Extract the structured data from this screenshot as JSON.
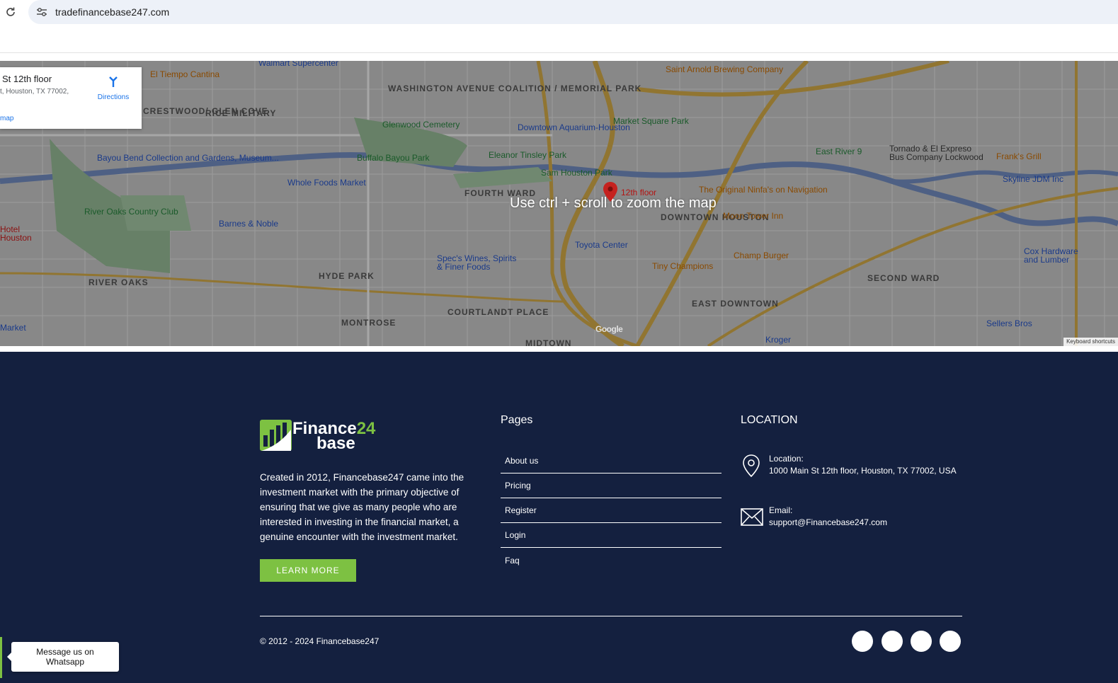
{
  "browser": {
    "url": "tradefinancebase247.com"
  },
  "map": {
    "zoom_hint": "Use ctrl + scroll to zoom the map",
    "card": {
      "title": "St 12th floor",
      "address": "t, Houston, TX 77002,",
      "directions_label": "Directions",
      "view_link": "map"
    },
    "marker_label": "12th floor",
    "google_logo": "Google",
    "keyboard_shortcuts": "Keyboard shortcuts",
    "areas": [
      "WASHINGTON AVENUE COALITION / MEMORIAL PARK",
      "CRESTWOOD/ GLEN COVE",
      "RICE MILITARY",
      "FOURTH WARD",
      "DOWNTOWN HOUSTON",
      "HYDE PARK",
      "RIVER OAKS",
      "MONTROSE",
      "COURTLANDT PLACE",
      "EAST DOWNTOWN",
      "SECOND WARD",
      "MIDTOWN"
    ],
    "pois": [
      "El Tiempo Cantina",
      "Walmart Supercenter",
      "Saint Arnold Brewing Company",
      "Market Square Park",
      "Downtown Aquarium-Houston",
      "Glenwood Cemetery",
      "Bayou Bend Collection and Gardens, Museum...",
      "Buffalo Bayou Park",
      "Eleanor Tinsley Park",
      "Sam Houston Park",
      "Whole Foods Market",
      "River Oaks Country Club",
      "Barnes & Noble",
      "The Original Ninfa's on Navigation",
      "Moon Tower Inn",
      "East River 9",
      "Tornado & El Expreso Bus Company Lockwood",
      "Frank's Grill",
      "Skyline JDM Inc",
      "Toyota Center",
      "Spec's Wines, Spirits & Finer Foods",
      "Champ Burger",
      "Tiny Champions",
      "Cox Hardware and Lumber",
      "Sellers Bros",
      "Kroger",
      "Hotel Houston",
      "Market"
    ]
  },
  "footer": {
    "logo": {
      "text_main": "Finance",
      "text_accent": "24",
      "text_line2": "base"
    },
    "about": "Created in 2012, Financebase247 came into the investment market with the primary objective of ensuring that we give as many people who are interested in investing in the financial market, a genuine encounter with the investment market.",
    "learn_more": "LEARN MORE",
    "pages_title": "Pages",
    "pages": [
      {
        "label": "About us"
      },
      {
        "label": "Pricing"
      },
      {
        "label": "Register"
      },
      {
        "label": "Login"
      },
      {
        "label": "Faq"
      }
    ],
    "location_title": "LOCATION",
    "location_label": "Location:",
    "location_value": "1000 Main St 12th floor, Houston, TX 77002, USA",
    "email_label": "Email:",
    "email_value": "support@Financebase247.com",
    "copyright": "© 2012 - 2024 Financebase247",
    "accent_color": "#7dc142",
    "background_color": "#14203f"
  },
  "whatsapp": {
    "tooltip": "Message us on Whatsapp"
  }
}
